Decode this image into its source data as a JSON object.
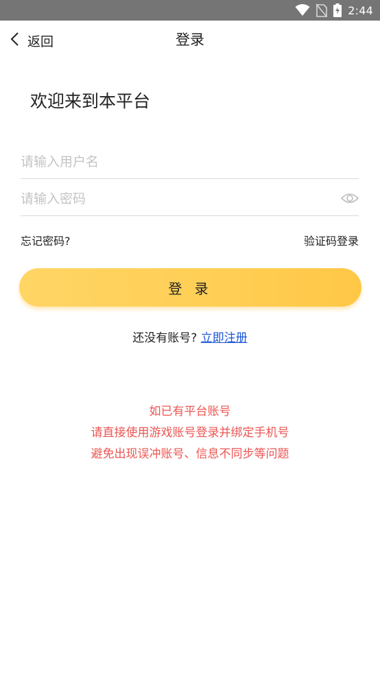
{
  "status_bar": {
    "time": "2:44",
    "icons": [
      "wifi-icon",
      "no-sim-icon",
      "battery-charging-icon"
    ]
  },
  "nav": {
    "back_label": "返回",
    "title": "登录"
  },
  "welcome": "欢迎来到本平台",
  "form": {
    "username_placeholder": "请输入用户名",
    "username_value": "",
    "password_placeholder": "请输入密码",
    "password_value": ""
  },
  "links": {
    "forgot_password": "忘记密码?",
    "sms_login": "验证码登录"
  },
  "login_button": "登 录",
  "register": {
    "prompt": "还没有账号?",
    "link": "立即注册"
  },
  "notice": {
    "lines": [
      "如已有平台账号",
      "请直接使用游戏账号登录并绑定手机号",
      "避免出现误冲账号、信息不同步等问题"
    ]
  },
  "colors": {
    "accent": "#ffcf56",
    "link": "#1a56d6",
    "notice": "#ec5552",
    "status_bar": "#757575"
  }
}
